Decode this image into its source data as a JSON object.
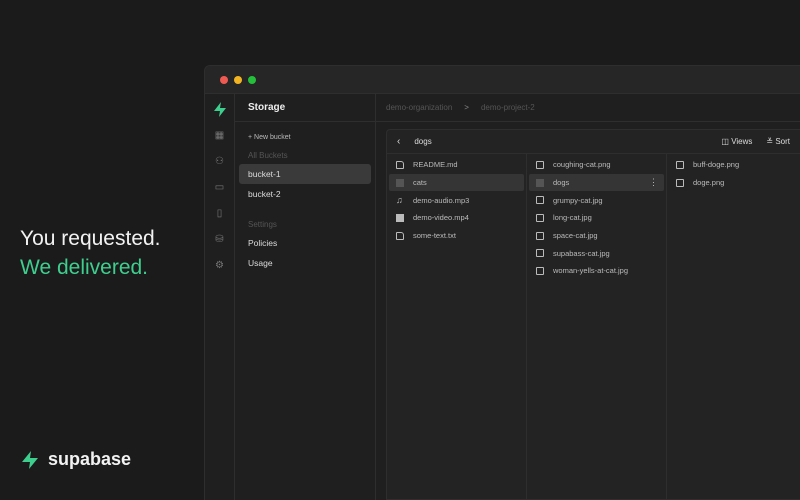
{
  "hero": {
    "line1": "You requested.",
    "line2": "We delivered."
  },
  "brand": {
    "name": "supabase",
    "accent": "#3ecf8e"
  },
  "sidebar": {
    "title": "Storage",
    "new_bucket": "New bucket",
    "all_buckets": "All Buckets",
    "buckets": [
      {
        "label": "bucket-1",
        "selected": true
      },
      {
        "label": "bucket-2"
      }
    ],
    "settings_label": "Settings",
    "settings": [
      {
        "label": "Policies"
      },
      {
        "label": "Usage"
      }
    ]
  },
  "breadcrumb": {
    "org": "demo-organization",
    "sep": ">",
    "project": "demo-project-2"
  },
  "explorer": {
    "path": "dogs",
    "views": "Views",
    "sort": "Sort",
    "columns": [
      [
        {
          "name": "README.md",
          "icon": "file"
        },
        {
          "name": "cats",
          "icon": "fold",
          "selected": true
        },
        {
          "name": "demo-audio.mp3",
          "icon": "music"
        },
        {
          "name": "demo-video.mp4",
          "icon": "video"
        },
        {
          "name": "some-text.txt",
          "icon": "file"
        }
      ],
      [
        {
          "name": "coughing-cat.png",
          "icon": "img"
        },
        {
          "name": "dogs",
          "icon": "fold",
          "selected": true
        },
        {
          "name": "grumpy-cat.jpg",
          "icon": "img"
        },
        {
          "name": "long-cat.jpg",
          "icon": "img"
        },
        {
          "name": "space-cat.jpg",
          "icon": "img"
        },
        {
          "name": "supabass-cat.jpg",
          "icon": "img"
        },
        {
          "name": "woman-yells-at-cat.jpg",
          "icon": "img"
        }
      ],
      [
        {
          "name": "buff-doge.png",
          "icon": "img"
        },
        {
          "name": "doge.png",
          "icon": "img"
        }
      ]
    ]
  }
}
